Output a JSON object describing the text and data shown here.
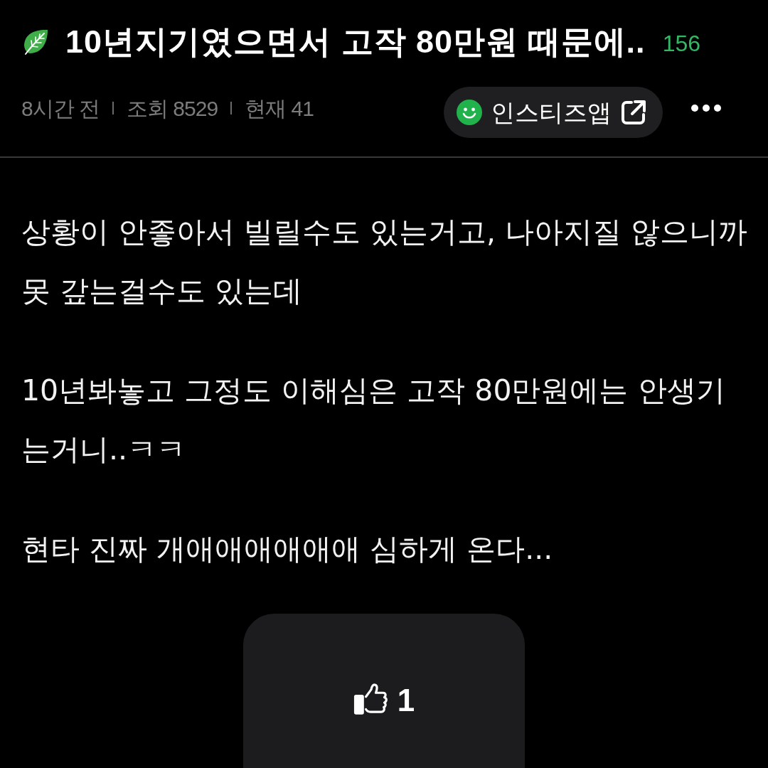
{
  "post": {
    "title": "10년지기였으면서 고작 80만원 때문에..",
    "comment_count": "156"
  },
  "meta": [
    "8시간 전",
    "조회 8529",
    "현재 41"
  ],
  "app_button": {
    "label": "인스티즈앱"
  },
  "body": [
    "상황이 안좋아서 빌릴수도 있는거고, 나아지질 않으니까 못 갚는걸수도 있는데",
    "10년봐놓고 그정도 이해심은 고작 80만원에는 안생기는거니..ㅋㅋ",
    "현타 진짜 개애애애애애애 심하게 온다..."
  ],
  "like_button": {
    "count": "1"
  }
}
